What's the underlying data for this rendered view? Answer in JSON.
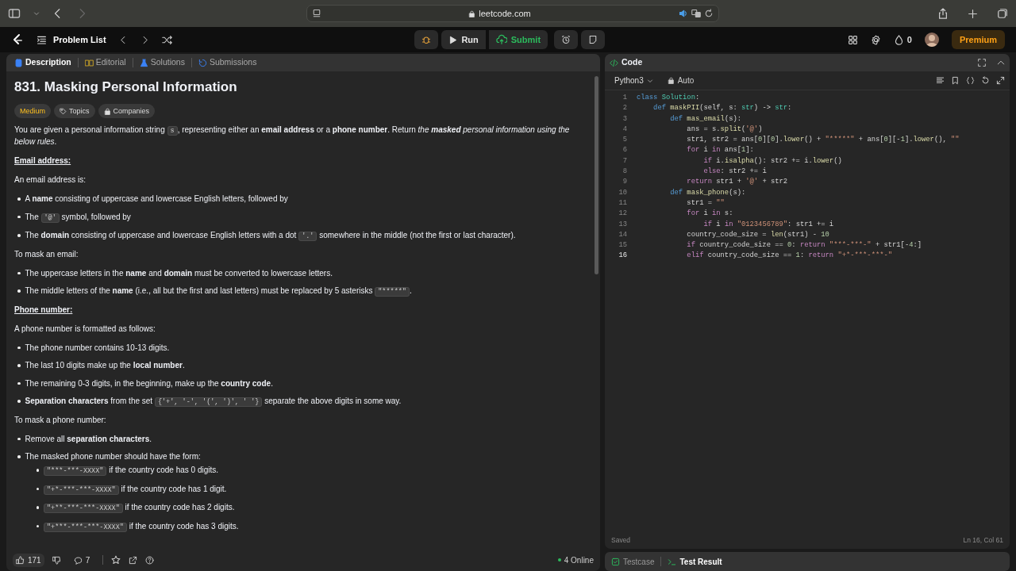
{
  "browser": {
    "url": "leetcode.com"
  },
  "nav": {
    "problem_list": "Problem List",
    "run": "Run",
    "submit": "Submit",
    "streak": "0",
    "premium": "Premium"
  },
  "left_tabs": [
    {
      "label": "Description",
      "selected": true
    },
    {
      "label": "Editorial",
      "selected": false
    },
    {
      "label": "Solutions",
      "selected": false
    },
    {
      "label": "Submissions",
      "selected": false
    }
  ],
  "problem": {
    "title": "831. Masking Personal Information",
    "difficulty": "Medium",
    "tags": [
      {
        "label": "Topics",
        "kind": "tag"
      },
      {
        "label": "Companies",
        "kind": "lock"
      }
    ],
    "content": [
      {
        "kind": "p",
        "parts": [
          {
            "kind": "text",
            "text": "You are given a personal information string "
          },
          {
            "kind": "code",
            "text": "s"
          },
          {
            "kind": "text",
            "text": ", representing either an **email address** or a **phone number**. Return "
          },
          {
            "kind": "em",
            "text": "the **masked** personal information using the below rules"
          },
          {
            "kind": "text",
            "text": "."
          }
        ]
      },
      {
        "kind": "heading",
        "text": "Email address:"
      },
      {
        "kind": "p",
        "parts": [
          {
            "kind": "text",
            "text": "An email address is:"
          }
        ]
      },
      {
        "kind": "list",
        "items": [
          {
            "parts": [
              {
                "kind": "text",
                "text": "A **name** consisting of uppercase and lowercase English letters, followed by"
              }
            ]
          },
          {
            "parts": [
              {
                "kind": "text",
                "text": "The "
              },
              {
                "kind": "code",
                "text": "'@'"
              },
              {
                "kind": "text",
                "text": " symbol, followed by"
              }
            ]
          },
          {
            "parts": [
              {
                "kind": "text",
                "text": "The **domain** consisting of uppercase and lowercase English letters with a dot "
              },
              {
                "kind": "code",
                "text": "'.'"
              },
              {
                "kind": "text",
                "text": " somewhere in the middle (not the first or last character)."
              }
            ]
          }
        ]
      },
      {
        "kind": "p",
        "parts": [
          {
            "kind": "text",
            "text": "To mask an email:"
          }
        ]
      },
      {
        "kind": "list",
        "items": [
          {
            "parts": [
              {
                "kind": "text",
                "text": "The uppercase letters in the **name** and **domain** must be converted to lowercase letters."
              }
            ]
          },
          {
            "parts": [
              {
                "kind": "text",
                "text": "The middle letters of the **name** (i.e., all but the first and last letters) must be replaced by 5 asterisks "
              },
              {
                "kind": "code",
                "text": "\"*****\""
              },
              {
                "kind": "text",
                "text": "."
              }
            ]
          }
        ]
      },
      {
        "kind": "heading",
        "text": "Phone number:"
      },
      {
        "kind": "p",
        "parts": [
          {
            "kind": "text",
            "text": "A phone number is formatted as follows:"
          }
        ]
      },
      {
        "kind": "list",
        "items": [
          {
            "parts": [
              {
                "kind": "text",
                "text": "The phone number contains 10-13 digits."
              }
            ]
          },
          {
            "parts": [
              {
                "kind": "text",
                "text": "The last 10 digits make up the **local number**."
              }
            ]
          },
          {
            "parts": [
              {
                "kind": "text",
                "text": "The remaining 0-3 digits, in the beginning, make up the **country code**."
              }
            ]
          },
          {
            "parts": [
              {
                "kind": "text",
                "text": "**Separation characters** from the set "
              },
              {
                "kind": "code",
                "text": "{'+', '-', '(', ')', ' '}"
              },
              {
                "kind": "text",
                "text": " separate the above digits in some way."
              }
            ]
          }
        ]
      },
      {
        "kind": "p",
        "parts": [
          {
            "kind": "text",
            "text": "To mask a phone number:"
          }
        ]
      },
      {
        "kind": "list",
        "items": [
          {
            "parts": [
              {
                "kind": "text",
                "text": "Remove all **separation characters**."
              }
            ]
          },
          {
            "parts": [
              {
                "kind": "text",
                "text": "The masked phone number should have the form:"
              }
            ],
            "children": [
              {
                "parts": [
                  {
                    "kind": "code",
                    "text": "\"***-***-XXXX\""
                  },
                  {
                    "kind": "text",
                    "text": " if the country code has 0 digits."
                  }
                ]
              },
              {
                "parts": [
                  {
                    "kind": "code",
                    "text": "\"+*-***-***-XXXX\""
                  },
                  {
                    "kind": "text",
                    "text": " if the country code has 1 digit."
                  }
                ]
              },
              {
                "parts": [
                  {
                    "kind": "code",
                    "text": "\"+**-***-***-XXXX\""
                  },
                  {
                    "kind": "text",
                    "text": " if the country code has 2 digits."
                  }
                ]
              },
              {
                "parts": [
                  {
                    "kind": "code",
                    "text": "\"+***-***-***-XXXX\""
                  },
                  {
                    "kind": "text",
                    "text": " if the country code has 3 digits."
                  }
                ]
              }
            ]
          }
        ]
      }
    ]
  },
  "footer": {
    "likes": "171",
    "comments": "7",
    "online": "4 Online"
  },
  "code_panel": {
    "title": "Code",
    "language": "Python3",
    "mode": "Auto",
    "status": "Saved",
    "cursor": "Ln 16, Col 61",
    "lines": [
      {
        "number": "1",
        "current": false,
        "tokens": [
          {
            "kind": "kw",
            "text": "class"
          },
          {
            "kind": "type",
            "text": " Solution"
          },
          {
            "kind": "plain",
            "text": ":"
          }
        ]
      },
      {
        "number": "2",
        "current": false,
        "tokens": [
          {
            "kind": "kw",
            "text": "    def"
          },
          {
            "kind": "fn",
            "text": " maskPII"
          },
          {
            "kind": "plain",
            "text": "(self, s: "
          },
          {
            "kind": "type",
            "text": "str"
          },
          {
            "kind": "plain",
            "text": ") -> "
          },
          {
            "kind": "type",
            "text": "str"
          },
          {
            "kind": "plain",
            "text": ":"
          }
        ]
      },
      {
        "number": "3",
        "current": false,
        "tokens": [
          {
            "kind": "kw",
            "text": "        def"
          },
          {
            "kind": "fn",
            "text": " mas_email"
          },
          {
            "kind": "plain",
            "text": "(s):"
          }
        ]
      },
      {
        "number": "4",
        "current": false,
        "tokens": [
          {
            "kind": "plain",
            "text": "            ans = s."
          },
          {
            "kind": "fn",
            "text": "split"
          },
          {
            "kind": "plain",
            "text": "("
          },
          {
            "kind": "str",
            "text": "'@'"
          },
          {
            "kind": "plain",
            "text": ")"
          }
        ]
      },
      {
        "number": "5",
        "current": false,
        "tokens": [
          {
            "kind": "plain",
            "text": "            str1, str2 = ans["
          },
          {
            "kind": "num",
            "text": "0"
          },
          {
            "kind": "plain",
            "text": "]["
          },
          {
            "kind": "num",
            "text": "0"
          },
          {
            "kind": "plain",
            "text": "]."
          },
          {
            "kind": "fn",
            "text": "lower"
          },
          {
            "kind": "plain",
            "text": "() + "
          },
          {
            "kind": "str",
            "text": "\"*****\""
          },
          {
            "kind": "plain",
            "text": " + ans["
          },
          {
            "kind": "num",
            "text": "0"
          },
          {
            "kind": "plain",
            "text": "][-"
          },
          {
            "kind": "num",
            "text": "1"
          },
          {
            "kind": "plain",
            "text": "]."
          },
          {
            "kind": "fn",
            "text": "lower"
          },
          {
            "kind": "plain",
            "text": "(), "
          },
          {
            "kind": "str",
            "text": "\"\""
          }
        ]
      },
      {
        "number": "6",
        "current": false,
        "tokens": [
          {
            "kind": "ctl",
            "text": "            for"
          },
          {
            "kind": "plain",
            "text": " i "
          },
          {
            "kind": "ctl",
            "text": "in"
          },
          {
            "kind": "plain",
            "text": " ans["
          },
          {
            "kind": "num",
            "text": "1"
          },
          {
            "kind": "plain",
            "text": "]:"
          }
        ]
      },
      {
        "number": "7",
        "current": false,
        "tokens": [
          {
            "kind": "ctl",
            "text": "                if"
          },
          {
            "kind": "plain",
            "text": " i."
          },
          {
            "kind": "fn",
            "text": "isalpha"
          },
          {
            "kind": "plain",
            "text": "(): str2 += i."
          },
          {
            "kind": "fn",
            "text": "lower"
          },
          {
            "kind": "plain",
            "text": "()"
          }
        ]
      },
      {
        "number": "8",
        "current": false,
        "tokens": [
          {
            "kind": "ctl",
            "text": "                else"
          },
          {
            "kind": "plain",
            "text": ": str2 += i"
          }
        ]
      },
      {
        "number": "9",
        "current": false,
        "tokens": [
          {
            "kind": "ctl",
            "text": "            return"
          },
          {
            "kind": "plain",
            "text": " str1 + "
          },
          {
            "kind": "str",
            "text": "'@'"
          },
          {
            "kind": "plain",
            "text": " + str2"
          }
        ]
      },
      {
        "number": "10",
        "current": false,
        "tokens": [
          {
            "kind": "kw",
            "text": "        def"
          },
          {
            "kind": "fn",
            "text": " mask_phone"
          },
          {
            "kind": "plain",
            "text": "(s):"
          }
        ]
      },
      {
        "number": "11",
        "current": false,
        "tokens": [
          {
            "kind": "plain",
            "text": "            str1 = "
          },
          {
            "kind": "str",
            "text": "\"\""
          }
        ]
      },
      {
        "number": "12",
        "current": false,
        "tokens": [
          {
            "kind": "ctl",
            "text": "            for"
          },
          {
            "kind": "plain",
            "text": " i "
          },
          {
            "kind": "ctl",
            "text": "in"
          },
          {
            "kind": "plain",
            "text": " s:"
          }
        ]
      },
      {
        "number": "13",
        "current": false,
        "tokens": [
          {
            "kind": "ctl",
            "text": "                if"
          },
          {
            "kind": "plain",
            "text": " i "
          },
          {
            "kind": "ctl",
            "text": "in"
          },
          {
            "kind": "str",
            "text": " \"0123456789\""
          },
          {
            "kind": "plain",
            "text": ": str1 += i"
          }
        ]
      },
      {
        "number": "14",
        "current": false,
        "tokens": [
          {
            "kind": "plain",
            "text": "            country_code_size = "
          },
          {
            "kind": "fn",
            "text": "len"
          },
          {
            "kind": "plain",
            "text": "(str1) - "
          },
          {
            "kind": "num",
            "text": "10"
          }
        ]
      },
      {
        "number": "15",
        "current": false,
        "tokens": [
          {
            "kind": "ctl",
            "text": "            if"
          },
          {
            "kind": "plain",
            "text": " country_code_size == "
          },
          {
            "kind": "num",
            "text": "0"
          },
          {
            "kind": "plain",
            "text": ": "
          },
          {
            "kind": "ctl",
            "text": "return"
          },
          {
            "kind": "str",
            "text": " \"***-***-\""
          },
          {
            "kind": "plain",
            "text": " + str1[-"
          },
          {
            "kind": "num",
            "text": "4"
          },
          {
            "kind": "plain",
            "text": ":]"
          }
        ]
      },
      {
        "number": "16",
        "current": true,
        "tokens": [
          {
            "kind": "ctl",
            "text": "            elif"
          },
          {
            "kind": "plain",
            "text": " country_code_size == "
          },
          {
            "kind": "num",
            "text": "1"
          },
          {
            "kind": "plain",
            "text": ": "
          },
          {
            "kind": "ctl",
            "text": "return"
          },
          {
            "kind": "str",
            "text": " \"+*-***-***-\""
          }
        ]
      }
    ]
  },
  "bottom_tabs": [
    {
      "label": "Testcase",
      "selected": false
    },
    {
      "label": "Test Result",
      "selected": true
    }
  ]
}
